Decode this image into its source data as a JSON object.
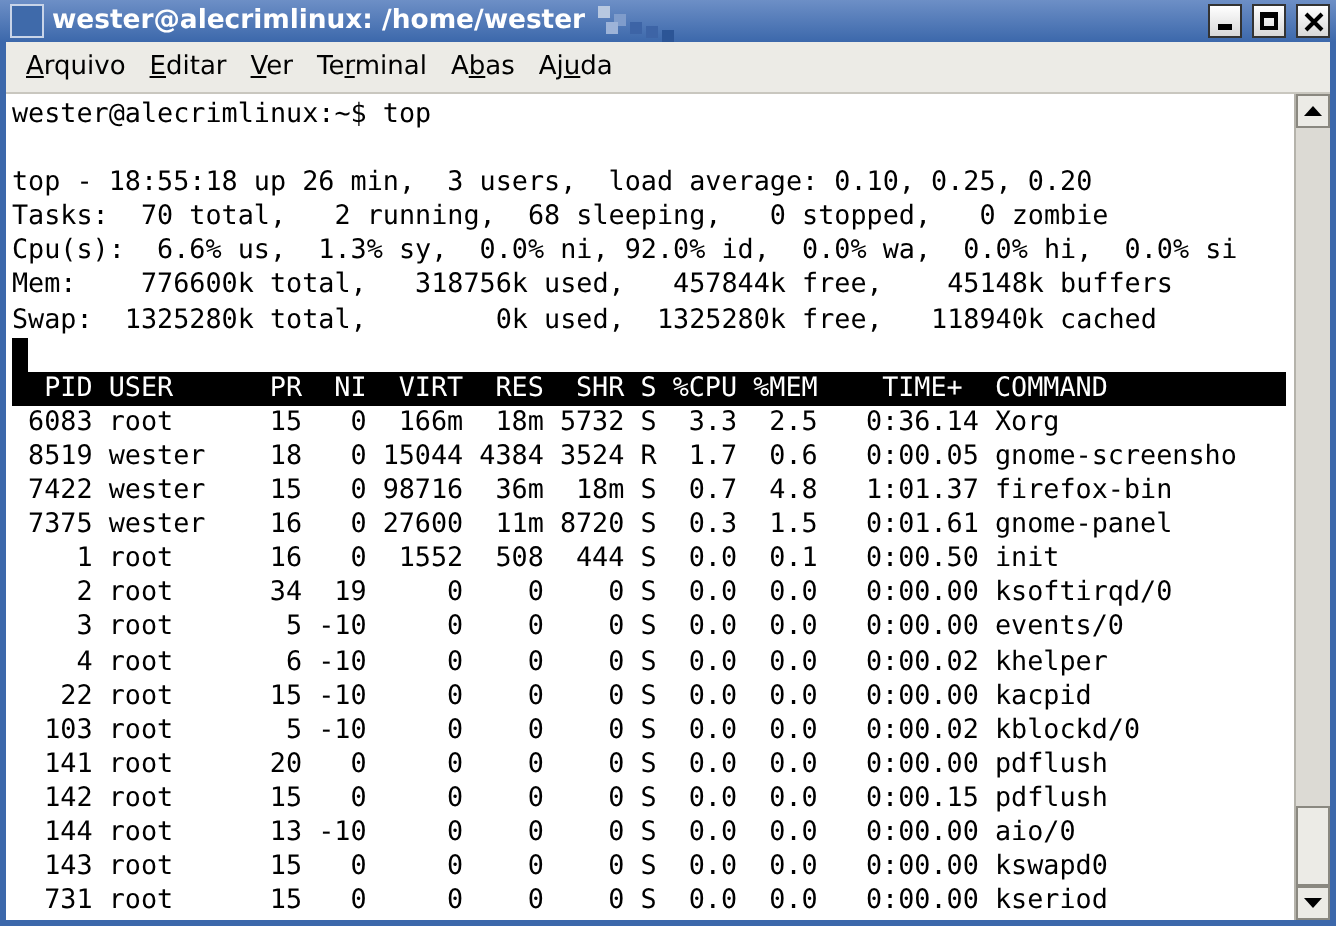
{
  "window": {
    "title": "wester@alecrimlinux: /home/wester"
  },
  "menu": [
    {
      "key": "A",
      "post": "rquivo"
    },
    {
      "key": "E",
      "post": "ditar"
    },
    {
      "key": "V",
      "post": "er"
    },
    {
      "pre": "Te",
      "key": "r",
      "post": "minal"
    },
    {
      "pre": "A",
      "key": "b",
      "post": "as"
    },
    {
      "pre": "Aj",
      "key": "u",
      "post": "da"
    }
  ],
  "terminal": {
    "prompt_line": "wester@alecrimlinux:~$ top",
    "summary": [
      "top - 18:55:18 up 26 min,  3 users,  load average: 0.10, 0.25, 0.20",
      "Tasks:  70 total,   2 running,  68 sleeping,   0 stopped,   0 zombie",
      "Cpu(s):  6.6% us,  1.3% sy,  0.0% ni, 92.0% id,  0.0% wa,  0.0% hi,  0.0% si",
      "Mem:    776600k total,   318756k used,   457844k free,    45148k buffers",
      "Swap:  1325280k total,        0k used,  1325280k free,   118940k cached"
    ],
    "cursor": true,
    "table": {
      "columns": [
        "PID",
        "USER",
        "PR",
        "NI",
        "VIRT",
        "RES",
        "SHR",
        "S",
        "%CPU",
        "%MEM",
        "TIME+",
        "COMMAND"
      ],
      "rows": [
        [
          "6083",
          "root",
          "15",
          "0",
          "166m",
          "18m",
          "5732",
          "S",
          "3.3",
          "2.5",
          "0:36.14",
          "Xorg"
        ],
        [
          "8519",
          "wester",
          "18",
          "0",
          "15044",
          "4384",
          "3524",
          "R",
          "1.7",
          "0.6",
          "0:00.05",
          "gnome-screensho"
        ],
        [
          "7422",
          "wester",
          "15",
          "0",
          "98716",
          "36m",
          "18m",
          "S",
          "0.7",
          "4.8",
          "1:01.37",
          "firefox-bin"
        ],
        [
          "7375",
          "wester",
          "16",
          "0",
          "27600",
          "11m",
          "8720",
          "S",
          "0.3",
          "1.5",
          "0:01.61",
          "gnome-panel"
        ],
        [
          "1",
          "root",
          "16",
          "0",
          "1552",
          "508",
          "444",
          "S",
          "0.0",
          "0.1",
          "0:00.50",
          "init"
        ],
        [
          "2",
          "root",
          "34",
          "19",
          "0",
          "0",
          "0",
          "S",
          "0.0",
          "0.0",
          "0:00.00",
          "ksoftirqd/0"
        ],
        [
          "3",
          "root",
          "5",
          "-10",
          "0",
          "0",
          "0",
          "S",
          "0.0",
          "0.0",
          "0:00.00",
          "events/0"
        ],
        [
          "4",
          "root",
          "6",
          "-10",
          "0",
          "0",
          "0",
          "S",
          "0.0",
          "0.0",
          "0:00.02",
          "khelper"
        ],
        [
          "22",
          "root",
          "15",
          "-10",
          "0",
          "0",
          "0",
          "S",
          "0.0",
          "0.0",
          "0:00.00",
          "kacpid"
        ],
        [
          "103",
          "root",
          "5",
          "-10",
          "0",
          "0",
          "0",
          "S",
          "0.0",
          "0.0",
          "0:00.02",
          "kblockd/0"
        ],
        [
          "141",
          "root",
          "20",
          "0",
          "0",
          "0",
          "0",
          "S",
          "0.0",
          "0.0",
          "0:00.00",
          "pdflush"
        ],
        [
          "142",
          "root",
          "15",
          "0",
          "0",
          "0",
          "0",
          "S",
          "0.0",
          "0.0",
          "0:00.15",
          "pdflush"
        ],
        [
          "144",
          "root",
          "13",
          "-10",
          "0",
          "0",
          "0",
          "S",
          "0.0",
          "0.0",
          "0:00.00",
          "aio/0"
        ],
        [
          "143",
          "root",
          "15",
          "0",
          "0",
          "0",
          "0",
          "S",
          "0.0",
          "0.0",
          "0:00.00",
          "kswapd0"
        ],
        [
          "731",
          "root",
          "15",
          "0",
          "0",
          "0",
          "0",
          "S",
          "0.0",
          "0.0",
          "0:00.00",
          "kseriod"
        ]
      ]
    }
  }
}
